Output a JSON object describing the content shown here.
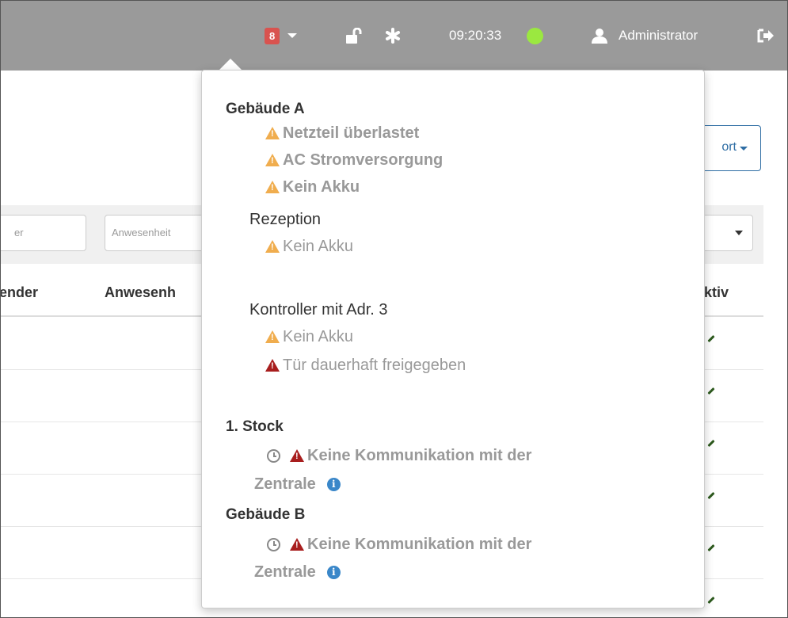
{
  "topbar": {
    "alarm_count": "8",
    "clock": "09:20:33",
    "user": "Administrator",
    "status_color": "#9be840",
    "icons": [
      "alarm-badge",
      "caret-down-icon",
      "unlock-icon",
      "asterisk-icon",
      "status-dot",
      "user-icon",
      "logout-icon"
    ]
  },
  "page": {
    "export_label": "ort",
    "filters": [
      "er",
      "Anwesenheit"
    ],
    "columns": [
      "ender",
      "Anwesenh",
      "ktiv"
    ]
  },
  "popover": {
    "groups": [
      {
        "title": "Gebäude A",
        "alerts": [
          "Netzteil überlastet",
          "AC Stromversorgung",
          "Kein Akku"
        ]
      },
      {
        "title": "Rezeption",
        "alerts": [
          "Kein Akku"
        ]
      },
      {
        "title": "Kontroller mit Adr. 3",
        "alerts": [
          "Kein Akku",
          "Tür dauerhaft freigegeben"
        ]
      },
      {
        "title": "1. Stock",
        "alerts": [
          "Keine Kommunikation mit der",
          "Zentrale"
        ]
      },
      {
        "title": "Gebäude B",
        "alerts": [
          "Keine Kommunikation mit der",
          "Zentrale"
        ]
      }
    ]
  },
  "colors": {
    "warning": "#f0ad4e",
    "danger": "#a81e1e",
    "info": "#3a87c9",
    "topbar": "#9a9a9a"
  }
}
